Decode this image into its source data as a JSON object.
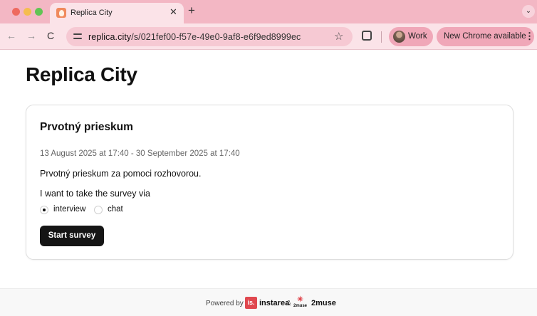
{
  "browser": {
    "tab_title": "Replica City",
    "tab_close": "✕",
    "new_tab": "+",
    "tab_menu": "⌄",
    "nav": {
      "back": "←",
      "forward": "→",
      "reload": "C"
    },
    "url_host": "replica.city",
    "url_path": "/s/021fef00-f57e-49e0-9af8-e6f9ed8999ec",
    "bookmark_icon": "☆",
    "profile_label": "Work",
    "update_label": "New Chrome available",
    "menu_icon": "⋮"
  },
  "page": {
    "title": "Replica City"
  },
  "survey": {
    "title": "Prvotný prieskum",
    "dates": "13 August 2025 at 17:40 - 30 September 2025 at 17:40",
    "description": "Prvotný prieskum za pomoci rozhovorou.",
    "prompt": "I want to take the survey via",
    "options": [
      {
        "label": "interview",
        "selected": true
      },
      {
        "label": "chat",
        "selected": false
      }
    ],
    "start_label": "Start survey"
  },
  "footer": {
    "powered_by": "Powered by",
    "instarea_mark": "is.",
    "instarea_name": "instarea",
    "ampersand": "&",
    "muse_mark": "✴",
    "muse_sub": "2muse",
    "muse_name": "2muse"
  },
  "colors": {
    "tabbar": "#f3b7c4",
    "toolbar": "#fbe3e8",
    "button_dark": "#151515",
    "instarea_red": "#e0484f"
  }
}
